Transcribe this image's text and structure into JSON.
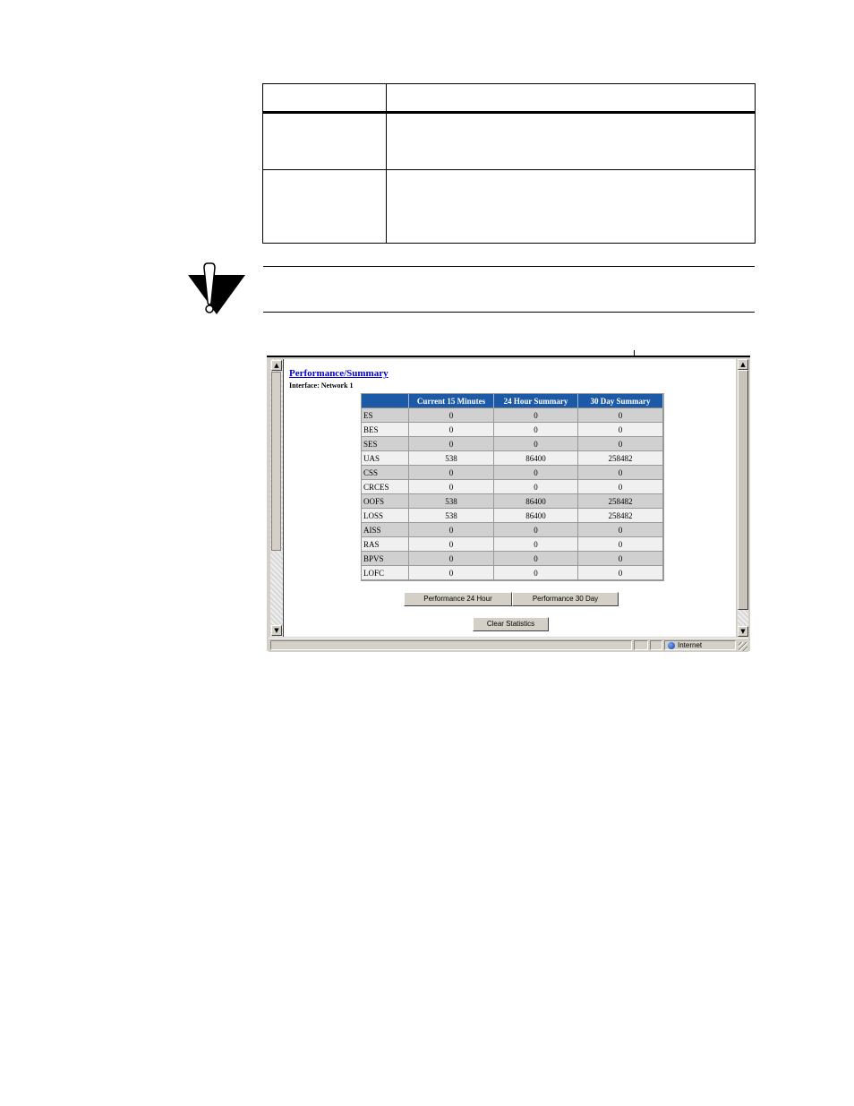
{
  "screenshot": {
    "page_title": "Performance/Summary",
    "interface_label": "Interface: Network 1",
    "table": {
      "headers": [
        "",
        "Current 15 Minutes",
        "24 Hour Summary",
        "30 Day Summary"
      ],
      "rows": [
        {
          "label": "ES",
          "current": "0",
          "h24": "0",
          "d30": "0"
        },
        {
          "label": "BES",
          "current": "0",
          "h24": "0",
          "d30": "0"
        },
        {
          "label": "SES",
          "current": "0",
          "h24": "0",
          "d30": "0"
        },
        {
          "label": "UAS",
          "current": "538",
          "h24": "86400",
          "d30": "258482"
        },
        {
          "label": "CSS",
          "current": "0",
          "h24": "0",
          "d30": "0"
        },
        {
          "label": "CRCES",
          "current": "0",
          "h24": "0",
          "d30": "0"
        },
        {
          "label": "OOFS",
          "current": "538",
          "h24": "86400",
          "d30": "258482"
        },
        {
          "label": "LOSS",
          "current": "538",
          "h24": "86400",
          "d30": "258482"
        },
        {
          "label": "AISS",
          "current": "0",
          "h24": "0",
          "d30": "0"
        },
        {
          "label": "RAS",
          "current": "0",
          "h24": "0",
          "d30": "0"
        },
        {
          "label": "BPVS",
          "current": "0",
          "h24": "0",
          "d30": "0"
        },
        {
          "label": "LOFC",
          "current": "0",
          "h24": "0",
          "d30": "0"
        }
      ]
    },
    "buttons": {
      "perf_24": "Performance 24 Hour",
      "perf_30": "Performance 30 Day",
      "clear": "Clear Statistics"
    },
    "status": {
      "zone": "Internet"
    },
    "scroll": {
      "up_glyph": "▲",
      "down_glyph": "▼"
    }
  },
  "icons": {
    "caution": "caution-icon",
    "zone": "globe-icon"
  }
}
